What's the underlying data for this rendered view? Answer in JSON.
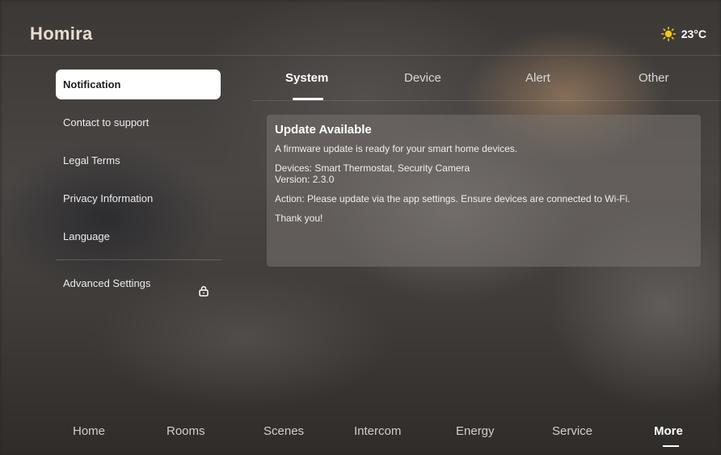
{
  "app": {
    "title": "Homira"
  },
  "weather": {
    "temperature": "23°C",
    "icon": "sun-icon",
    "icon_color": "#f5c518"
  },
  "sidebar": {
    "items": [
      {
        "label": "Notification",
        "active": true
      },
      {
        "label": "Contact to support"
      },
      {
        "label": "Legal Terms"
      },
      {
        "label": "Privacy Information"
      },
      {
        "label": "Language"
      }
    ],
    "advanced": {
      "label": "Advanced Settings",
      "icon": "lock-icon"
    }
  },
  "tabs": [
    {
      "label": "System",
      "active": true
    },
    {
      "label": "Device"
    },
    {
      "label": "Alert"
    },
    {
      "label": "Other"
    }
  ],
  "notification": {
    "title": "Update Available",
    "intro": "A firmware update is ready for your smart home devices.",
    "devices": "Devices: Smart Thermostat, Security Camera",
    "version": "Version: 2.3.0",
    "action": "Action: Please update via the app settings. Ensure devices are connected to Wi-Fi.",
    "closing": "Thank you!"
  },
  "bottom_nav": [
    {
      "label": "Home"
    },
    {
      "label": "Rooms"
    },
    {
      "label": "Scenes"
    },
    {
      "label": "Intercom"
    },
    {
      "label": "Energy"
    },
    {
      "label": "Service"
    },
    {
      "label": "More",
      "active": true
    }
  ]
}
